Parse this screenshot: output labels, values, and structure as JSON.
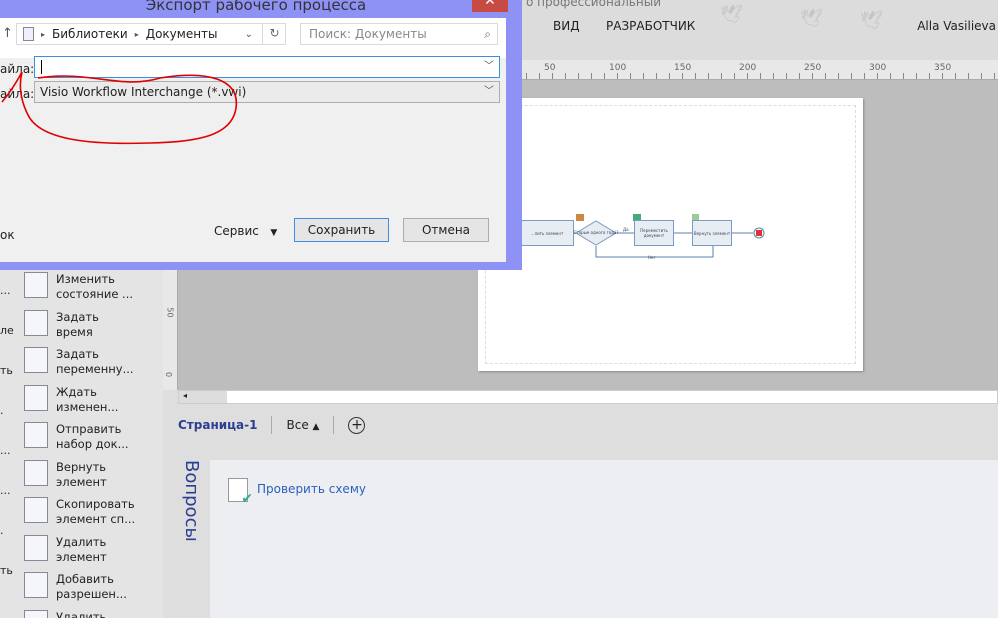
{
  "app": {
    "title_fragment": "о профессиональный",
    "tabs": [
      "ВИД",
      "РАЗРАБОТЧИК"
    ],
    "user": "Alla Vasilieva"
  },
  "ruler": {
    "labels": [
      "50",
      "100",
      "150",
      "200",
      "250",
      "300",
      "350"
    ],
    "vlabels": [
      "50",
      "0"
    ]
  },
  "diagram": {
    "shapes": [
      "...лить элемент",
      "Старые одного года?",
      "Переместить документ",
      "Вернуть элемент"
    ],
    "yes_label": "Да",
    "no_label": "Нет"
  },
  "stencil": {
    "items": [
      "Изменить состояние ...",
      "Задать время",
      "Задать переменну...",
      "Ждать изменен...",
      "Отправить набор док...",
      "Вернуть элемент",
      "Скопировать элемент сп...",
      "Удалить элемент",
      "Добавить разрешен...",
      "Удалить"
    ],
    "fragments": [
      "...",
      "ле",
      "ть",
      ".",
      "...",
      "...",
      ".",
      "ть"
    ]
  },
  "pagetabs": {
    "page": "Страница-1",
    "all": "Все"
  },
  "issues": {
    "title": "Вопросы",
    "check_link": "Проверить схему"
  },
  "dialog": {
    "title": "Экспорт рабочего процесса",
    "close": "✕",
    "breadcrumb": [
      "Библиотеки",
      "Документы"
    ],
    "search_placeholder": "Поиск: Документы",
    "file_name_label": "айла:",
    "file_name_value": "",
    "file_type_label": "айла:",
    "file_type_value": "Visio Workflow Interchange (*.vwi)",
    "hide_fragment": "ок",
    "service": "Сервис",
    "save": "Сохранить",
    "cancel": "Отмена"
  },
  "colors": {
    "dialog_border": "#8f92f5",
    "annotation": "#e00000",
    "link": "#2b5fbf"
  }
}
